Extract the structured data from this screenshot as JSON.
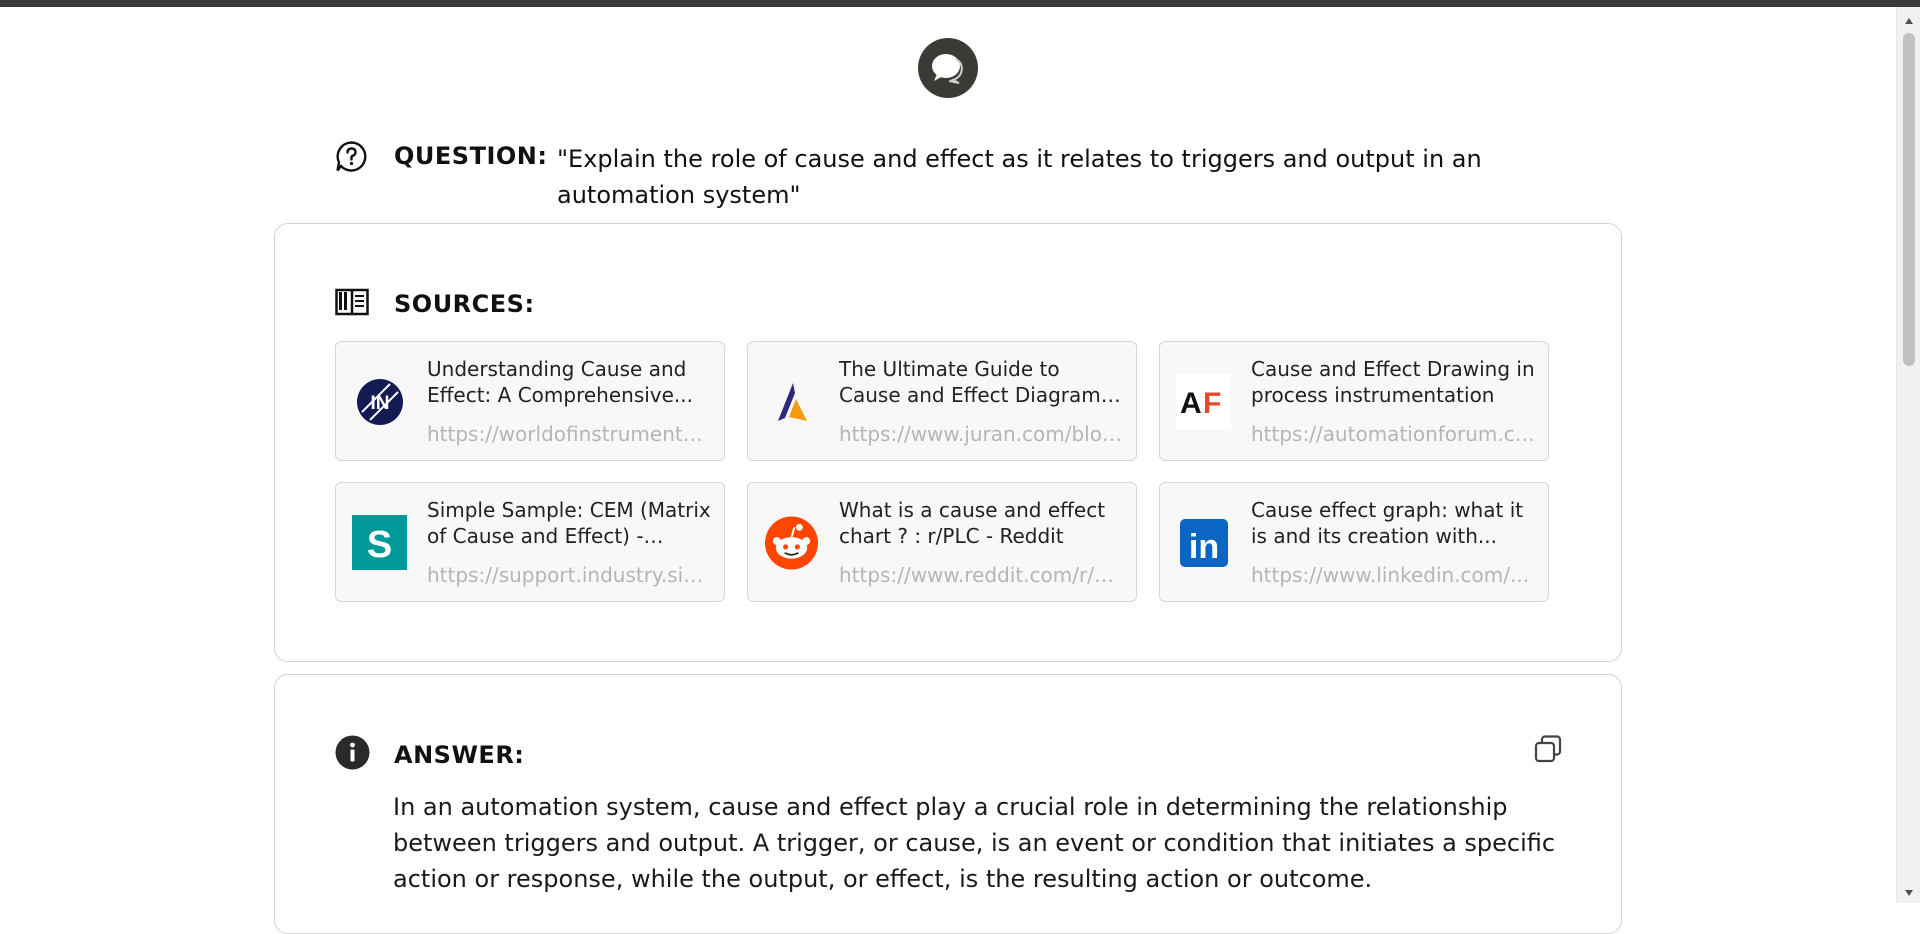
{
  "question": {
    "label": "QUESTION:",
    "text": "\"Explain the role of cause and effect as it relates to triggers and output in an automation system\""
  },
  "sources": {
    "label": "SOURCES:",
    "items": [
      {
        "title": "Understanding Cause and Effect: A Comprehensive...",
        "url": "https://worldofinstrumentation.com/...",
        "logo": "IN",
        "icon": "worldofinstrumentation-logo"
      },
      {
        "title": "The Ultimate Guide to Cause and Effect Diagrams - Juran",
        "url": "https://www.juran.com/blog/...",
        "logo": "",
        "icon": "juran-logo"
      },
      {
        "title": "Cause and Effect Drawing in process instrumentation",
        "url": "https://automationforum.co/...",
        "logo": "AF",
        "icon": "automationforum-logo"
      },
      {
        "title": "Simple Sample: CEM (Matrix of Cause and Effect) - Siemens",
        "url": "https://support.industry.siemens.com/...",
        "logo": "S",
        "icon": "siemens-logo"
      },
      {
        "title": "What is a cause and effect chart ? : r/PLC - Reddit",
        "url": "https://www.reddit.com/r/PLC/...",
        "logo": "",
        "icon": "reddit-logo"
      },
      {
        "title": "Cause effect graph: what it is and its creation with...",
        "url": "https://www.linkedin.com/...",
        "logo": "in",
        "icon": "linkedin-logo"
      }
    ]
  },
  "answer": {
    "label": "ANSWER:",
    "text": "In an automation system, cause and effect play a crucial role in determining the relationship between triggers and output. A trigger, or cause, is an event or condition that initiates a specific action or response, while the output, or effect, is the resulting action or outcome."
  },
  "icons": {
    "logo": "chat-bubble-icon",
    "question": "question-bubble-icon",
    "sources": "book-icon",
    "answer": "info-icon",
    "copy": "copy-icon"
  },
  "colors": {
    "logo_bg": "#3b3a36",
    "card_bg": "#f8f8f8",
    "url_text": "#b5b5b5",
    "reddit": "#ff4500",
    "linkedin": "#0a66c2",
    "siemens": "#009999",
    "juran": "#2e2a7a"
  }
}
